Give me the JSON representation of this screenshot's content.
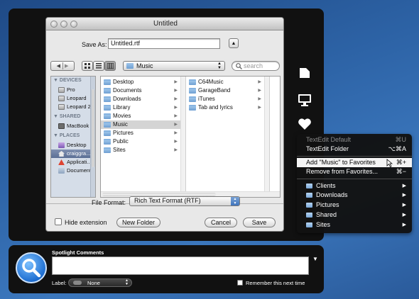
{
  "dialog": {
    "title": "Untitled",
    "save_as_label": "Save As:",
    "filename": "Untitled.rtf",
    "location": "Music",
    "search_placeholder": "search",
    "file_format_label": "File Format:",
    "file_format_value": "Rich Text Format (RTF)",
    "hide_extension_label": "Hide extension",
    "new_folder_label": "New Folder",
    "cancel_label": "Cancel",
    "save_label": "Save"
  },
  "sidebar": {
    "devices_header": "DEVICES",
    "devices": [
      "Pro",
      "Leopard",
      "Leopard 2"
    ],
    "shared_header": "SHARED",
    "shared": [
      "MacBook"
    ],
    "places_header": "PLACES",
    "places": [
      "Desktop",
      "craiggra...",
      "Applicati...",
      "Documents"
    ]
  },
  "browser": {
    "column1": [
      "Desktop",
      "Documents",
      "Downloads",
      "Library",
      "Movies",
      "Music",
      "Pictures",
      "Public",
      "Sites"
    ],
    "column1_selected": "Music",
    "column2": [
      "C64Music",
      "GarageBand",
      "iTunes",
      "Tab and lyrics"
    ]
  },
  "hud_menu": {
    "textedit_default": "TextEdit Default",
    "textedit_default_shortcut": "⌘U",
    "textedit_folder": "TextEdit Folder",
    "textedit_folder_shortcut": "⌥⌘A",
    "add_favorite": "Add \"Music\" to Favorites",
    "add_favorite_shortcut": "⌘+",
    "remove_favorites": "Remove from Favorites...",
    "remove_favorites_shortcut": "⌘−",
    "folders": [
      "Clients",
      "Downloads",
      "Pictures",
      "Shared",
      "Sites"
    ]
  },
  "spotlight": {
    "comments_label": "Spotlight Comments",
    "label_caption": "Label:",
    "label_value": "None",
    "remember_label": "Remember this next time"
  },
  "side_icons": [
    "document-icon",
    "monitor-icon",
    "heart-icon"
  ]
}
